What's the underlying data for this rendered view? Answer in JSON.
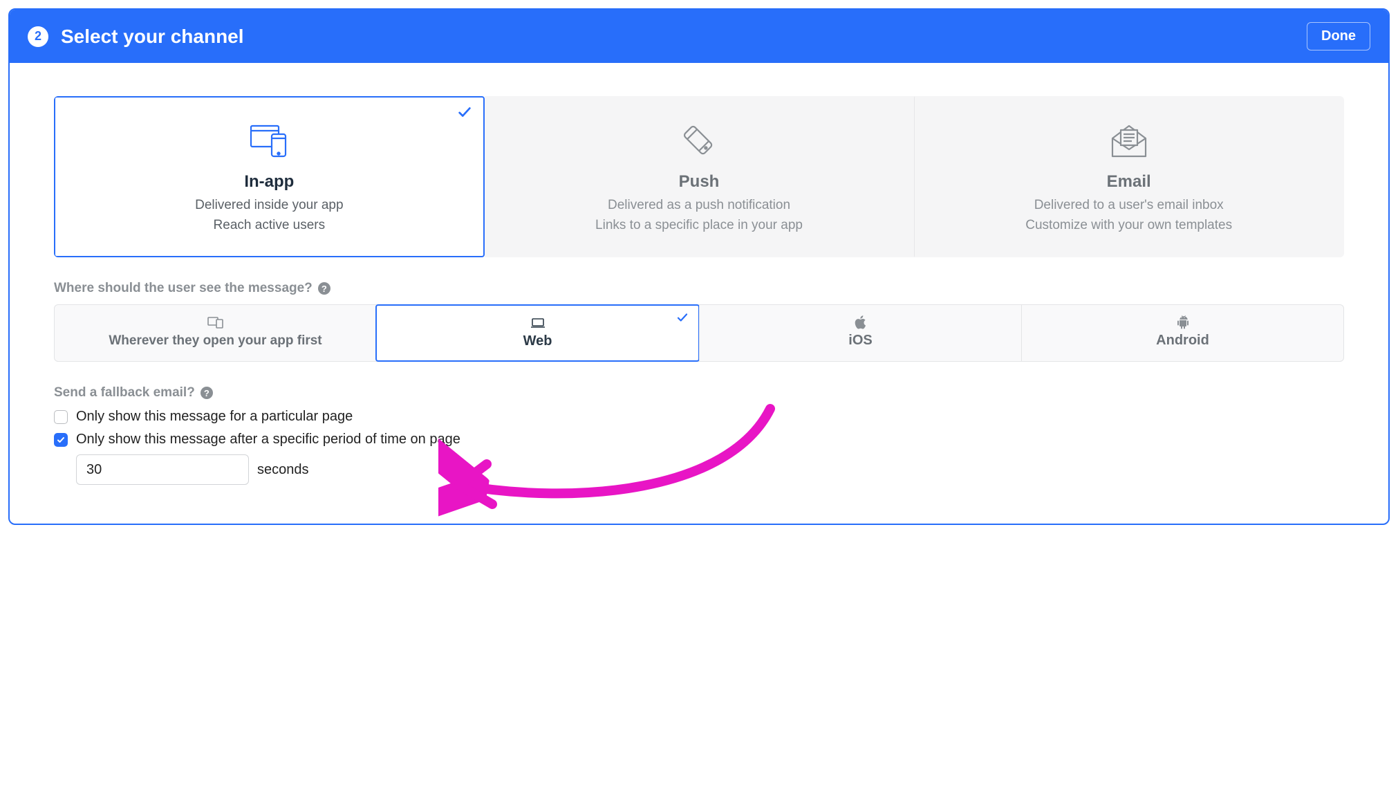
{
  "header": {
    "step_number": "2",
    "title": "Select your channel",
    "done_label": "Done"
  },
  "channels": {
    "in_app": {
      "title": "In-app",
      "line1": "Delivered inside your app",
      "line2": "Reach active users"
    },
    "push": {
      "title": "Push",
      "line1": "Delivered as a push notification",
      "line2": "Links to a specific place in your app"
    },
    "email": {
      "title": "Email",
      "line1": "Delivered to a user's email inbox",
      "line2": "Customize with your own templates"
    }
  },
  "location": {
    "label": "Where should the user see the message?",
    "tabs": {
      "wherever": "Wherever they open your app first",
      "web": "Web",
      "ios": "iOS",
      "android": "Android"
    }
  },
  "fallback": {
    "label": "Send a fallback email?",
    "option_page": "Only show this message for a particular page",
    "option_time": "Only show this message after a specific period of time on page",
    "time_value": "30",
    "seconds_label": "seconds"
  }
}
